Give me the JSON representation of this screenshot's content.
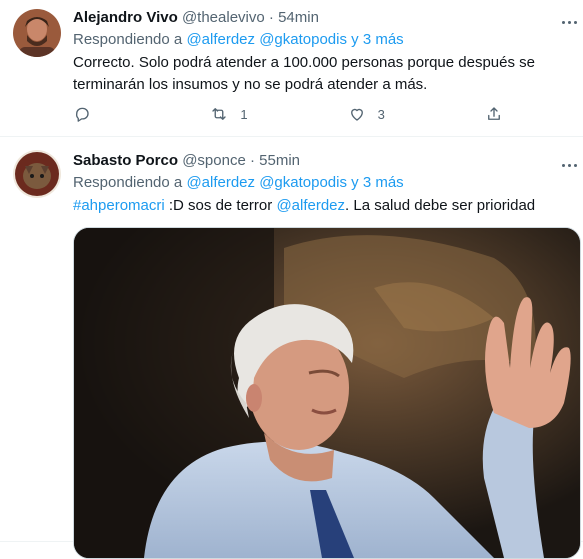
{
  "tweets": [
    {
      "name": "Alejandro Vivo",
      "handle": "@thealevivo",
      "time": "54min",
      "replying_prefix": "Respondiendo a",
      "replying_to": [
        "@alferdez",
        "@gkatopodis"
      ],
      "replying_more": "y 3 más",
      "text": "Correcto. Solo podrá atender a 100.000 personas porque después se terminarán los insumos y no se podrá atender a más.",
      "retweets": "1",
      "likes": "3"
    },
    {
      "name": "Sabasto Porco",
      "handle": "@sponce",
      "time": "55min",
      "replying_prefix": "Respondiendo a",
      "replying_to": [
        "@alferdez",
        "@gkatopodis"
      ],
      "replying_more": "y 3 más",
      "hashtag": "#ahperomacri",
      "text_mid": ":D sos de terror",
      "mention": "@alferdez",
      "text_end": ". La salud debe ser prioridad"
    }
  ],
  "icons": {
    "reply": "reply-icon",
    "retweet": "retweet-icon",
    "like": "heart-icon",
    "share": "share-icon",
    "more": "more-icon"
  },
  "colors": {
    "link": "#1d9bf0",
    "muted": "#536471",
    "text": "#0f1419",
    "divider": "#eff3f4"
  }
}
